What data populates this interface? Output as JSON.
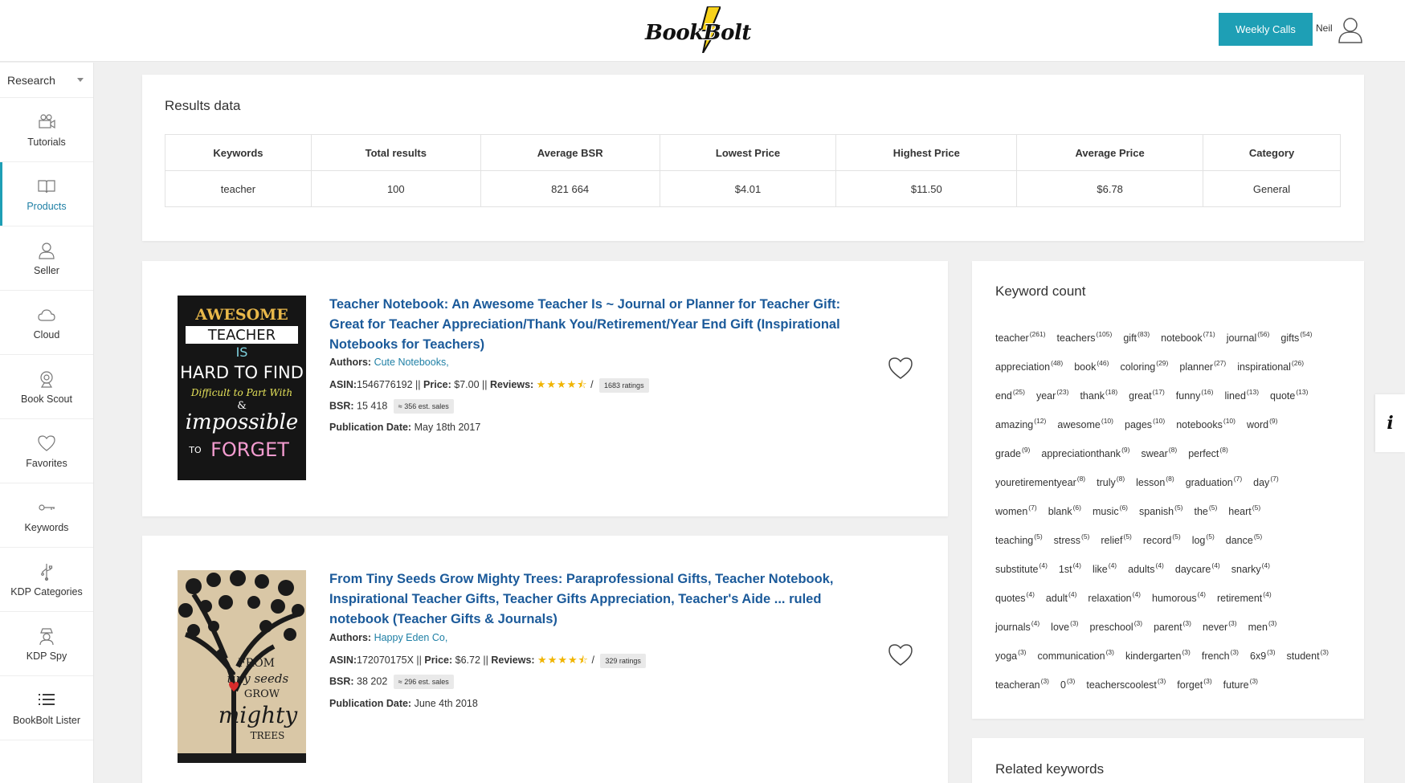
{
  "header": {
    "logo_text": "BookBolt",
    "weekly_calls_label": "Weekly Calls",
    "user_name": "Neil",
    "accent_color": "#1e9fb5"
  },
  "sidebar": {
    "select_value": "Research",
    "items": [
      {
        "label": "Tutorials",
        "icon": "video-camera-icon"
      },
      {
        "label": "Products",
        "icon": "book-icon",
        "active": true
      },
      {
        "label": "Seller",
        "icon": "user-icon"
      },
      {
        "label": "Cloud",
        "icon": "cloud-icon"
      },
      {
        "label": "Book Scout",
        "icon": "webcam-icon"
      },
      {
        "label": "Favorites",
        "icon": "heart-icon"
      },
      {
        "label": "Keywords",
        "icon": "key-icon"
      },
      {
        "label": "KDP Categories",
        "icon": "usb-icon"
      },
      {
        "label": "KDP Spy",
        "icon": "spy-icon"
      },
      {
        "label": "BookBolt Lister",
        "icon": "list-icon"
      }
    ]
  },
  "results": {
    "title": "Results data",
    "columns": [
      "Keywords",
      "Total results",
      "Average BSR",
      "Lowest Price",
      "Highest Price",
      "Average Price",
      "Category"
    ],
    "row": [
      "teacher",
      "100",
      "821 664",
      "$4.01",
      "$11.50",
      "$6.78",
      "General"
    ]
  },
  "books": [
    {
      "title": "Teacher Notebook: An Awesome Teacher Is ~ Journal or Planner for Teacher Gift: Great for Teacher Appreciation/Thank You/Retirement/Year End Gift (Inspirational Notebooks for Teachers)",
      "authors_label": "Authors:",
      "author": "Cute Notebooks,",
      "asin_label": "ASIN:",
      "asin": "1546776192",
      "price_label": "Price:",
      "price": "$7.00",
      "reviews_label": "Reviews:",
      "ratings": "1683 ratings",
      "rating_value": 4.5,
      "bsr_label": "BSR:",
      "bsr": "15 418",
      "est_sales": "≈ 356 est. sales",
      "pub_label": "Publication Date:",
      "pub_date": "May 18th 2017",
      "cover_lines": [
        "AWESOME",
        "TEACHER",
        "IS",
        "HARD TO FIND",
        "Difficult to Part With",
        "&",
        "impossible",
        "TO",
        "FORGET"
      ]
    },
    {
      "title": "From Tiny Seeds Grow Mighty Trees: Paraprofessional Gifts, Teacher Notebook, Inspirational Teacher Gifts, Teacher Gifts Appreciation, Teacher's Aide ... ruled notebook (Teacher Gifts & Journals)",
      "authors_label": "Authors:",
      "author": "Happy Eden Co,",
      "asin_label": "ASIN:",
      "asin": "172070175X",
      "price_label": "Price:",
      "price": "$6.72",
      "reviews_label": "Reviews:",
      "ratings": "329 ratings",
      "rating_value": 4.5,
      "bsr_label": "BSR:",
      "bsr": "38 202",
      "est_sales": "≈ 296 est. sales",
      "pub_label": "Publication Date:",
      "pub_date": "June 4th 2018",
      "cover_lines": [
        "FROM",
        "tiny seeds",
        "GROW",
        "mighty",
        "TREES"
      ]
    }
  ],
  "keyword_count": {
    "title": "Keyword count",
    "items": [
      [
        "teacher",
        "261"
      ],
      [
        "teachers",
        "105"
      ],
      [
        "gift",
        "83"
      ],
      [
        "notebook",
        "71"
      ],
      [
        "journal",
        "56"
      ],
      [
        "gifts",
        "54"
      ],
      [
        "appreciation",
        "48"
      ],
      [
        "book",
        "46"
      ],
      [
        "coloring",
        "29"
      ],
      [
        "planner",
        "27"
      ],
      [
        "inspirational",
        "26"
      ],
      [
        "end",
        "25"
      ],
      [
        "year",
        "23"
      ],
      [
        "thank",
        "18"
      ],
      [
        "great",
        "17"
      ],
      [
        "funny",
        "16"
      ],
      [
        "lined",
        "13"
      ],
      [
        "quote",
        "13"
      ],
      [
        "amazing",
        "12"
      ],
      [
        "awesome",
        "10"
      ],
      [
        "pages",
        "10"
      ],
      [
        "notebooks",
        "10"
      ],
      [
        "word",
        "9"
      ],
      [
        "grade",
        "9"
      ],
      [
        "appreciationthank",
        "9"
      ],
      [
        "swear",
        "8"
      ],
      [
        "perfect",
        "8"
      ],
      [
        "youretirementyear",
        "8"
      ],
      [
        "truly",
        "8"
      ],
      [
        "lesson",
        "8"
      ],
      [
        "graduation",
        "7"
      ],
      [
        "day",
        "7"
      ],
      [
        "women",
        "7"
      ],
      [
        "blank",
        "6"
      ],
      [
        "music",
        "6"
      ],
      [
        "spanish",
        "5"
      ],
      [
        "the",
        "5"
      ],
      [
        "heart",
        "5"
      ],
      [
        "teaching",
        "5"
      ],
      [
        "stress",
        "5"
      ],
      [
        "relief",
        "5"
      ],
      [
        "record",
        "5"
      ],
      [
        "log",
        "5"
      ],
      [
        "dance",
        "5"
      ],
      [
        "substitute",
        "4"
      ],
      [
        "1st",
        "4"
      ],
      [
        "like",
        "4"
      ],
      [
        "adults",
        "4"
      ],
      [
        "daycare",
        "4"
      ],
      [
        "snarky",
        "4"
      ],
      [
        "quotes",
        "4"
      ],
      [
        "adult",
        "4"
      ],
      [
        "relaxation",
        "4"
      ],
      [
        "humorous",
        "4"
      ],
      [
        "retirement",
        "4"
      ],
      [
        "journals",
        "4"
      ],
      [
        "love",
        "3"
      ],
      [
        "preschool",
        "3"
      ],
      [
        "parent",
        "3"
      ],
      [
        "never",
        "3"
      ],
      [
        "men",
        "3"
      ],
      [
        "yoga",
        "3"
      ],
      [
        "communication",
        "3"
      ],
      [
        "kindergarten",
        "3"
      ],
      [
        "french",
        "3"
      ],
      [
        "6x9",
        "3"
      ],
      [
        "student",
        "3"
      ],
      [
        "teacheran",
        "3"
      ],
      [
        "0",
        "3"
      ],
      [
        "teacherscoolest",
        "3"
      ],
      [
        "forget",
        "3"
      ],
      [
        "future",
        "3"
      ]
    ]
  },
  "related_keywords": {
    "title": "Related keywords"
  },
  "info_tab_label": "i"
}
